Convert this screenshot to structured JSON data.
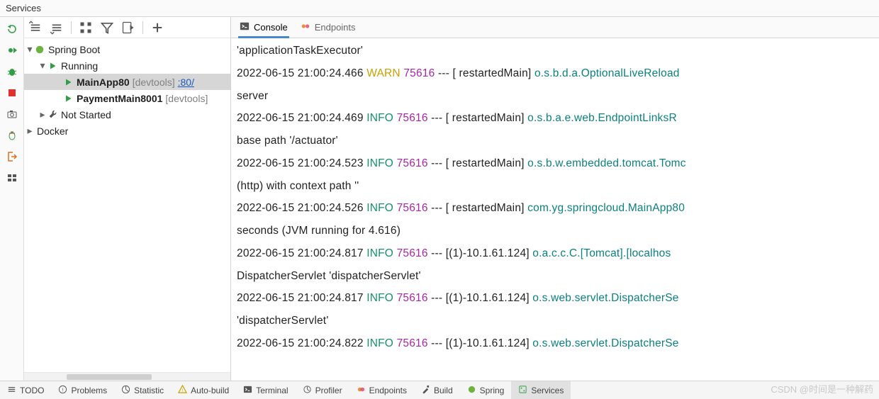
{
  "title": "Services",
  "gutterIcons": [
    "rerun-icon",
    "debug1-icon",
    "bug-icon",
    "stop-icon",
    "camera-icon",
    "heap-icon",
    "exit-icon",
    "layout-icon"
  ],
  "treeToolbarIcons": [
    "collapse-all-icon",
    "expand-all-icon",
    "group-icon",
    "filter-icon",
    "config-icon",
    "add-icon"
  ],
  "tree": {
    "root1": {
      "label": "Spring Boot"
    },
    "running": {
      "label": "Running"
    },
    "app1": {
      "name": "MainApp80",
      "tag": "[devtools]",
      "port": ":80/"
    },
    "app2": {
      "name": "PaymentMain8001",
      "tag": "[devtools]"
    },
    "notstarted": {
      "label": "Not Started"
    },
    "root2": {
      "label": "Docker"
    }
  },
  "tabs": {
    "console": "Console",
    "endpoints": "Endpoints"
  },
  "colors": {
    "info": "#169268",
    "warn": "#c9a100",
    "pid": "#a626a4",
    "clsname": "#0d8080",
    "link": "#1a57c4"
  },
  "log": [
    {
      "cont": " 'applicationTaskExecutor'"
    },
    {
      "ts": "2022-06-15 21:00:24.466",
      "level": "WARN",
      "pid": "75616",
      "thread": "  restartedMain",
      "cls": "o.s.b.d.a.OptionalLiveReload",
      "cont": " server"
    },
    {
      "ts": "2022-06-15 21:00:24.469",
      "level": "INFO",
      "pid": "75616",
      "thread": "  restartedMain",
      "cls": "o.s.b.a.e.web.EndpointLinksR",
      "cont": " base path '/actuator'"
    },
    {
      "ts": "2022-06-15 21:00:24.523",
      "level": "INFO",
      "pid": "75616",
      "thread": "  restartedMain",
      "cls": "o.s.b.w.embedded.tomcat.Tomc",
      "cont": " (http) with context path ''"
    },
    {
      "ts": "2022-06-15 21:00:24.526",
      "level": "INFO",
      "pid": "75616",
      "thread": "  restartedMain",
      "cls": "com.yg.springcloud.MainApp80",
      "cont": " seconds (JVM running for 4.616)"
    },
    {
      "ts": "2022-06-15 21:00:24.817",
      "level": "INFO",
      "pid": "75616",
      "thread": "(1)-10.1.61.124",
      "cls": "o.a.c.c.C.[Tomcat].[localhos",
      "cont": " DispatcherServlet 'dispatcherServlet'"
    },
    {
      "ts": "2022-06-15 21:00:24.817",
      "level": "INFO",
      "pid": "75616",
      "thread": "(1)-10.1.61.124",
      "cls": "o.s.web.servlet.DispatcherSe",
      "cont": " 'dispatcherServlet'"
    },
    {
      "ts": "2022-06-15 21:00:24.822",
      "level": "INFO",
      "pid": "75616",
      "thread": "(1)-10.1.61.124",
      "cls": "o.s.web.servlet.DispatcherSe"
    }
  ],
  "bottom": [
    {
      "name": "todo",
      "label": "TODO"
    },
    {
      "name": "problems",
      "label": "Problems"
    },
    {
      "name": "statistic",
      "label": "Statistic"
    },
    {
      "name": "autobuild",
      "label": "Auto-build"
    },
    {
      "name": "terminal",
      "label": "Terminal"
    },
    {
      "name": "profiler",
      "label": "Profiler"
    },
    {
      "name": "endpoints",
      "label": "Endpoints"
    },
    {
      "name": "build",
      "label": "Build"
    },
    {
      "name": "spring",
      "label": "Spring"
    },
    {
      "name": "services",
      "label": "Services",
      "active": true
    }
  ],
  "watermark": "CSDN @时间是一种解药"
}
